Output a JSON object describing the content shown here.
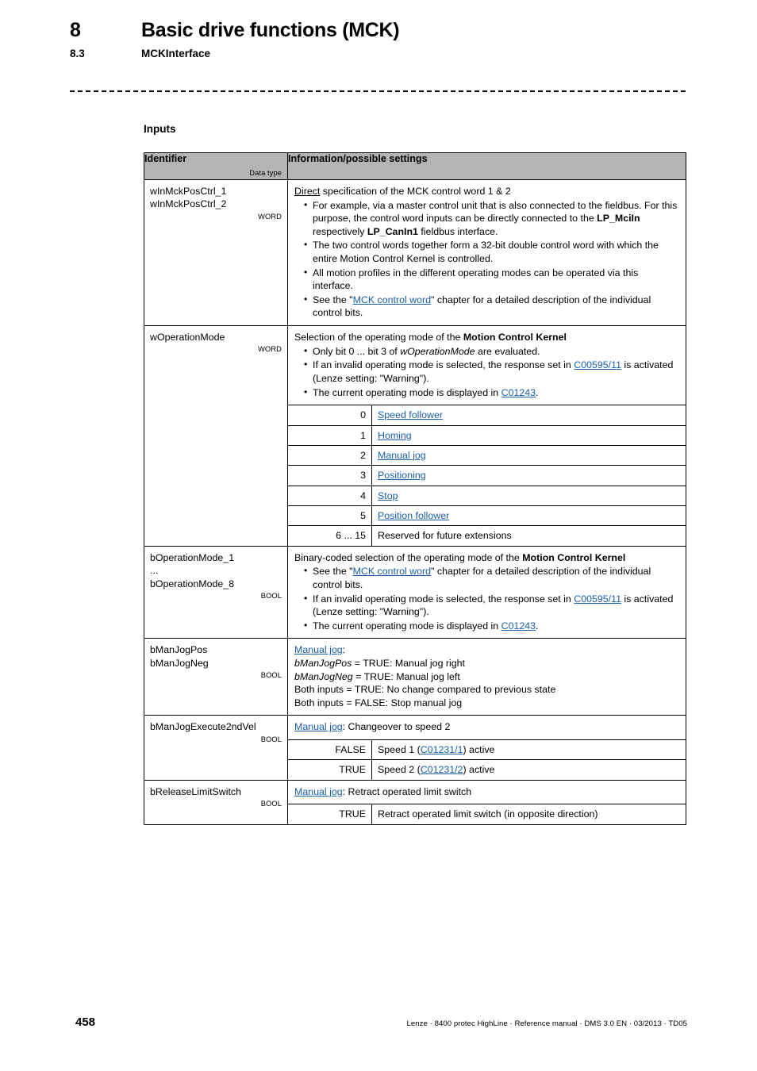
{
  "header": {
    "chapter_number": "8",
    "chapter_title": "Basic drive functions (MCK)",
    "section_number": "8.3",
    "section_title": "MCKInterface"
  },
  "section_label": "Inputs",
  "table": {
    "columns": {
      "identifier": "Identifier",
      "data_type": "Data type",
      "information": "Information/possible settings"
    },
    "rows": [
      {
        "names": [
          "wInMckPosCtrl_1",
          "wInMckPosCtrl_2"
        ],
        "data_type": "WORD",
        "lead_underlined": "Direct",
        "lead_rest": " specification of the MCK control word 1 & 2",
        "bullets": [
          {
            "parts": [
              {
                "t": "For example, via a master control unit that is also connected to the fieldbus. For this purpose, the control word inputs can be directly connected to the "
              },
              {
                "t": "LP_MciIn",
                "style": "bold"
              },
              {
                "t": " respectively "
              },
              {
                "t": "LP_CanIn1",
                "style": "bold"
              },
              {
                "t": " fieldbus interface."
              }
            ]
          },
          {
            "parts": [
              {
                "t": "The two control words together form a 32-bit double control word with which the entire Motion Control Kernel is controlled."
              }
            ]
          },
          {
            "parts": [
              {
                "t": "All motion profiles in the different operating modes can be operated via this interface."
              }
            ]
          },
          {
            "parts": [
              {
                "t": "See the \""
              },
              {
                "t": "MCK control word",
                "style": "link"
              },
              {
                "t": "\" chapter for a detailed description of the individual control bits."
              }
            ]
          }
        ]
      },
      {
        "names": [
          "wOperationMode"
        ],
        "data_type": "WORD",
        "lead_parts": [
          {
            "t": "Selection of the operating mode of the "
          },
          {
            "t": "Motion Control Kernel",
            "style": "bold"
          }
        ],
        "bullets": [
          {
            "parts": [
              {
                "t": "Only bit 0 ... bit 3 of "
              },
              {
                "t": "wOperationMode",
                "style": "italic"
              },
              {
                "t": " are evaluated."
              }
            ]
          },
          {
            "parts": [
              {
                "t": "If an invalid operating mode is selected, the response set in "
              },
              {
                "t": "C00595/11",
                "style": "link"
              },
              {
                "t": " is activated (Lenze setting: \"Warning\")."
              }
            ]
          },
          {
            "parts": [
              {
                "t": "The current operating mode is displayed in "
              },
              {
                "t": "C01243",
                "style": "link"
              },
              {
                "t": "."
              }
            ]
          }
        ],
        "subtable": [
          {
            "key": "0",
            "value": "Speed follower",
            "value_style": "link"
          },
          {
            "key": "1",
            "value": "Homing",
            "value_style": "link"
          },
          {
            "key": "2",
            "value": "Manual jog",
            "value_style": "link"
          },
          {
            "key": "3",
            "value": "Positioning",
            "value_style": "link"
          },
          {
            "key": "4",
            "value": "Stop",
            "value_style": "link"
          },
          {
            "key": "5",
            "value": "Position follower",
            "value_style": "link"
          },
          {
            "key": "6 ... 15",
            "value": "Reserved for future extensions",
            "value_style": "plain"
          }
        ]
      },
      {
        "names": [
          "bOperationMode_1",
          "...",
          "bOperationMode_8"
        ],
        "data_type": "BOOL",
        "lead_parts": [
          {
            "t": "Binary-coded selection of the operating mode of the "
          },
          {
            "t": "Motion Control Kernel",
            "style": "bold"
          }
        ],
        "bullets": [
          {
            "parts": [
              {
                "t": "See the \""
              },
              {
                "t": "MCK control word",
                "style": "link"
              },
              {
                "t": "\" chapter for a detailed description of the individual control bits."
              }
            ]
          },
          {
            "parts": [
              {
                "t": "If an invalid operating mode is selected, the response set in "
              },
              {
                "t": "C00595/11",
                "style": "link"
              },
              {
                "t": " is activated (Lenze setting: \"Warning\")."
              }
            ]
          },
          {
            "parts": [
              {
                "t": "The current operating mode is displayed in "
              },
              {
                "t": "C01243",
                "style": "link"
              },
              {
                "t": "."
              }
            ]
          }
        ]
      },
      {
        "names": [
          "bManJogPos",
          "bManJogNeg"
        ],
        "data_type": "BOOL",
        "lines": [
          [
            {
              "t": "Manual jog",
              "style": "link"
            },
            {
              "t": ":"
            }
          ],
          [
            {
              "t": "bManJogPos",
              "style": "italic"
            },
            {
              "t": " = TRUE: Manual jog right"
            }
          ],
          [
            {
              "t": "bManJogNeg",
              "style": "italic"
            },
            {
              "t": " = TRUE: Manual jog left"
            }
          ],
          [
            {
              "t": "Both inputs = TRUE: No change compared to previous state"
            }
          ],
          [
            {
              "t": "Both inputs = FALSE: Stop manual jog"
            }
          ]
        ]
      },
      {
        "names": [
          "bManJogExecute2ndVel"
        ],
        "data_type": "BOOL",
        "lines": [
          [
            {
              "t": "Manual jog",
              "style": "link"
            },
            {
              "t": ": Changeover to speed 2"
            }
          ]
        ],
        "subtable": [
          {
            "key": "FALSE",
            "value_parts": [
              {
                "t": "Speed 1 ("
              },
              {
                "t": "C01231/1",
                "style": "link"
              },
              {
                "t": ") active"
              }
            ]
          },
          {
            "key": "TRUE",
            "value_parts": [
              {
                "t": "Speed 2 ("
              },
              {
                "t": "C01231/2",
                "style": "link"
              },
              {
                "t": ") active"
              }
            ]
          }
        ]
      },
      {
        "names": [
          "bReleaseLimitSwitch"
        ],
        "data_type": "BOOL",
        "lines": [
          [
            {
              "t": "Manual jog",
              "style": "link"
            },
            {
              "t": ": Retract operated limit switch"
            }
          ]
        ],
        "subtable": [
          {
            "key": "TRUE",
            "value_parts": [
              {
                "t": "Retract operated limit switch (in opposite direction)"
              }
            ]
          }
        ]
      }
    ]
  },
  "footer": {
    "page_number": "458",
    "note": "Lenze · 8400 protec HighLine · Reference manual · DMS 3.0 EN · 03/2013 · TD05"
  },
  "colors": {
    "header_bg": "#b4b4b4",
    "link": "#1a5fa8",
    "rule": "#000000"
  }
}
